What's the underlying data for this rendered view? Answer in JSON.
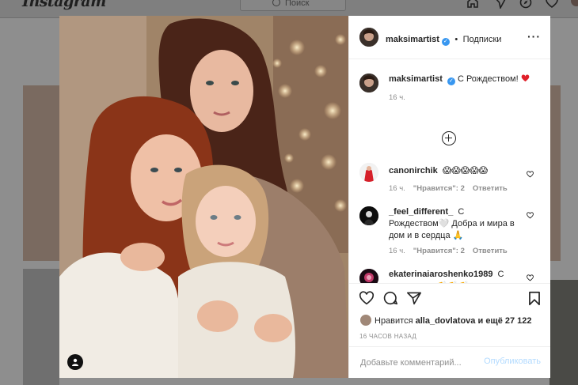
{
  "bg_header": {
    "logo": "Instagram",
    "search_placeholder": "Поиск"
  },
  "post": {
    "author": "maksimartist",
    "follow_label": "Подписки",
    "caption": "С Рождеством!",
    "caption_time": "16 ч.",
    "comments": [
      {
        "user": "canonirchik",
        "text": "😱😱😱😱😱",
        "time": "16 ч.",
        "likes_label": "\"Нравится\": 2",
        "reply_label": "Ответить"
      },
      {
        "user": "_feel_different_",
        "text": "С Рождеством🤍 Добра и мира в дом и в сердца 🙏",
        "time": "16 ч.",
        "likes_label": "\"Нравится\": 2",
        "reply_label": "Ответить"
      },
      {
        "user": "ekaterinaiaroshenko1989",
        "text": "С праздником👏👏👏",
        "time": "",
        "likes_label": "",
        "reply_label": ""
      }
    ],
    "liked_by_prefix": "Нравится",
    "liked_by_user": "alla_dovlatova",
    "liked_by_suffix": "и ещё 27 122",
    "time_ago": "16 ЧАСОВ НАЗАД",
    "comment_placeholder": "Добавьте комментарий...",
    "publish_label": "Опубликовать"
  },
  "colors": {
    "accent": "#3897f0",
    "publish_disabled": "#b3dbff",
    "heart": "#ed4956"
  }
}
